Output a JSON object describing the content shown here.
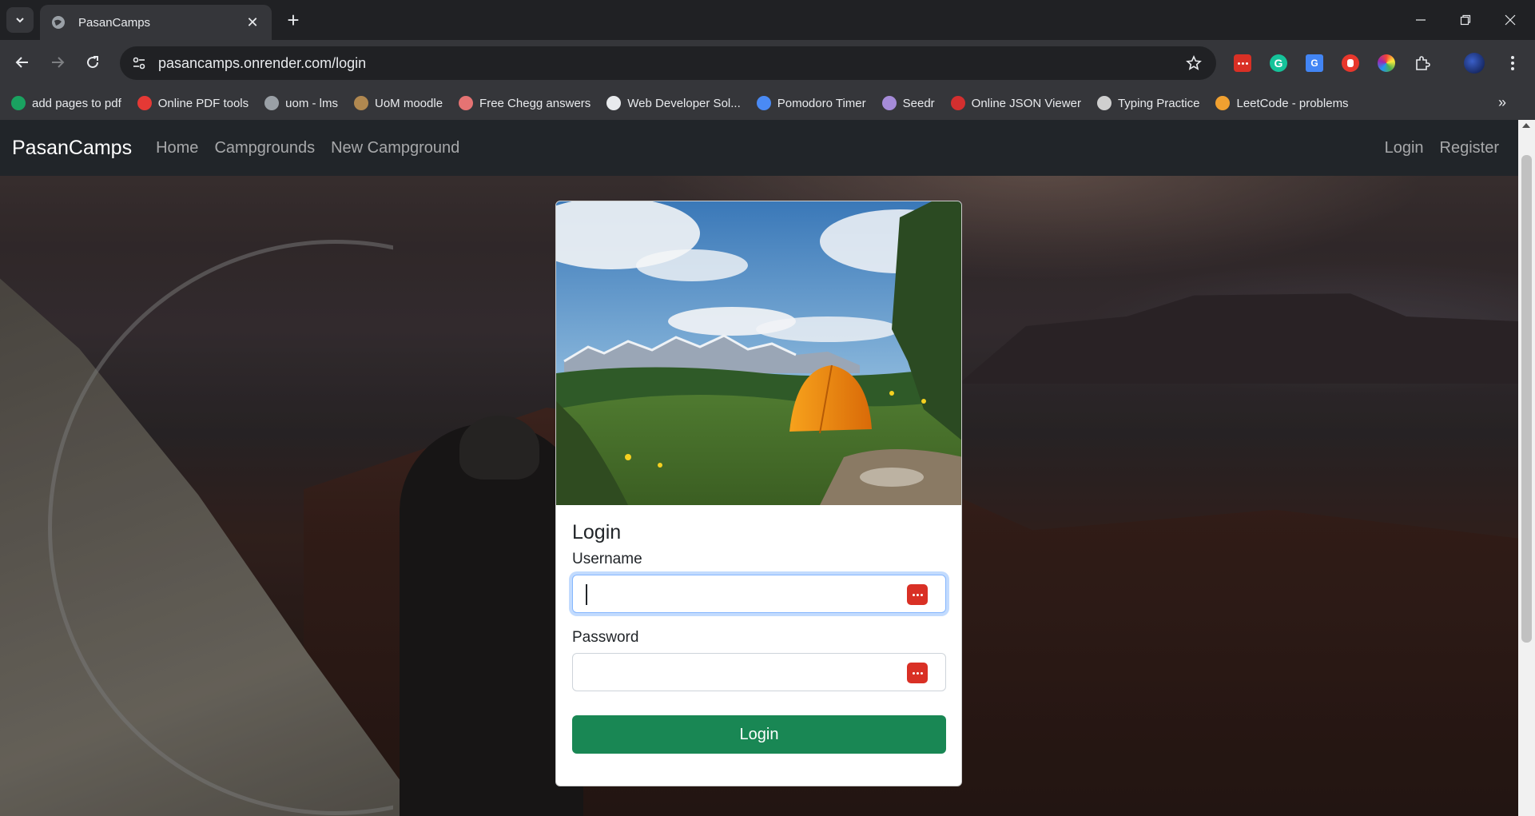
{
  "browser": {
    "tab": {
      "title": "PasanCamps"
    },
    "address": {
      "url": "pasancamps.onrender.com/login"
    },
    "bookmarks": [
      {
        "label": "add pages to pdf",
        "icon": "s-icon",
        "color": "#1aa260"
      },
      {
        "label": "Online PDF tools",
        "icon": "heart-icon",
        "color": "#e53935"
      },
      {
        "label": "uom - lms",
        "icon": "globe-icon",
        "color": "#9aa0a6"
      },
      {
        "label": "UoM moodle",
        "icon": "moodle-icon",
        "color": "#b08850"
      },
      {
        "label": "Free Chegg answers",
        "icon": "stack-icon",
        "color": "#e57373"
      },
      {
        "label": "Web Developer Sol...",
        "icon": "github-icon",
        "color": "#e8eaed"
      },
      {
        "label": "Pomodoro Timer",
        "icon": "check-circle-icon",
        "color": "#4a8af4"
      },
      {
        "label": "Seedr",
        "icon": "seed-icon",
        "color": "#a58bd8"
      },
      {
        "label": "Online JSON Viewer",
        "icon": "opera-icon",
        "color": "#d32f2f"
      },
      {
        "label": "Typing Practice",
        "icon": "keyboard-icon",
        "color": "#cfcfcf"
      },
      {
        "label": "LeetCode - problems",
        "icon": "leetcode-icon",
        "color": "#f0a030"
      }
    ]
  },
  "site": {
    "brand": "PasanCamps",
    "nav": {
      "home": "Home",
      "campgrounds": "Campgrounds",
      "new_campground": "New Campground",
      "login": "Login",
      "register": "Register"
    }
  },
  "login_card": {
    "title": "Login",
    "username_label": "Username",
    "username_value": "",
    "password_label": "Password",
    "password_value": "",
    "submit_label": "Login",
    "accent": "#198754"
  }
}
